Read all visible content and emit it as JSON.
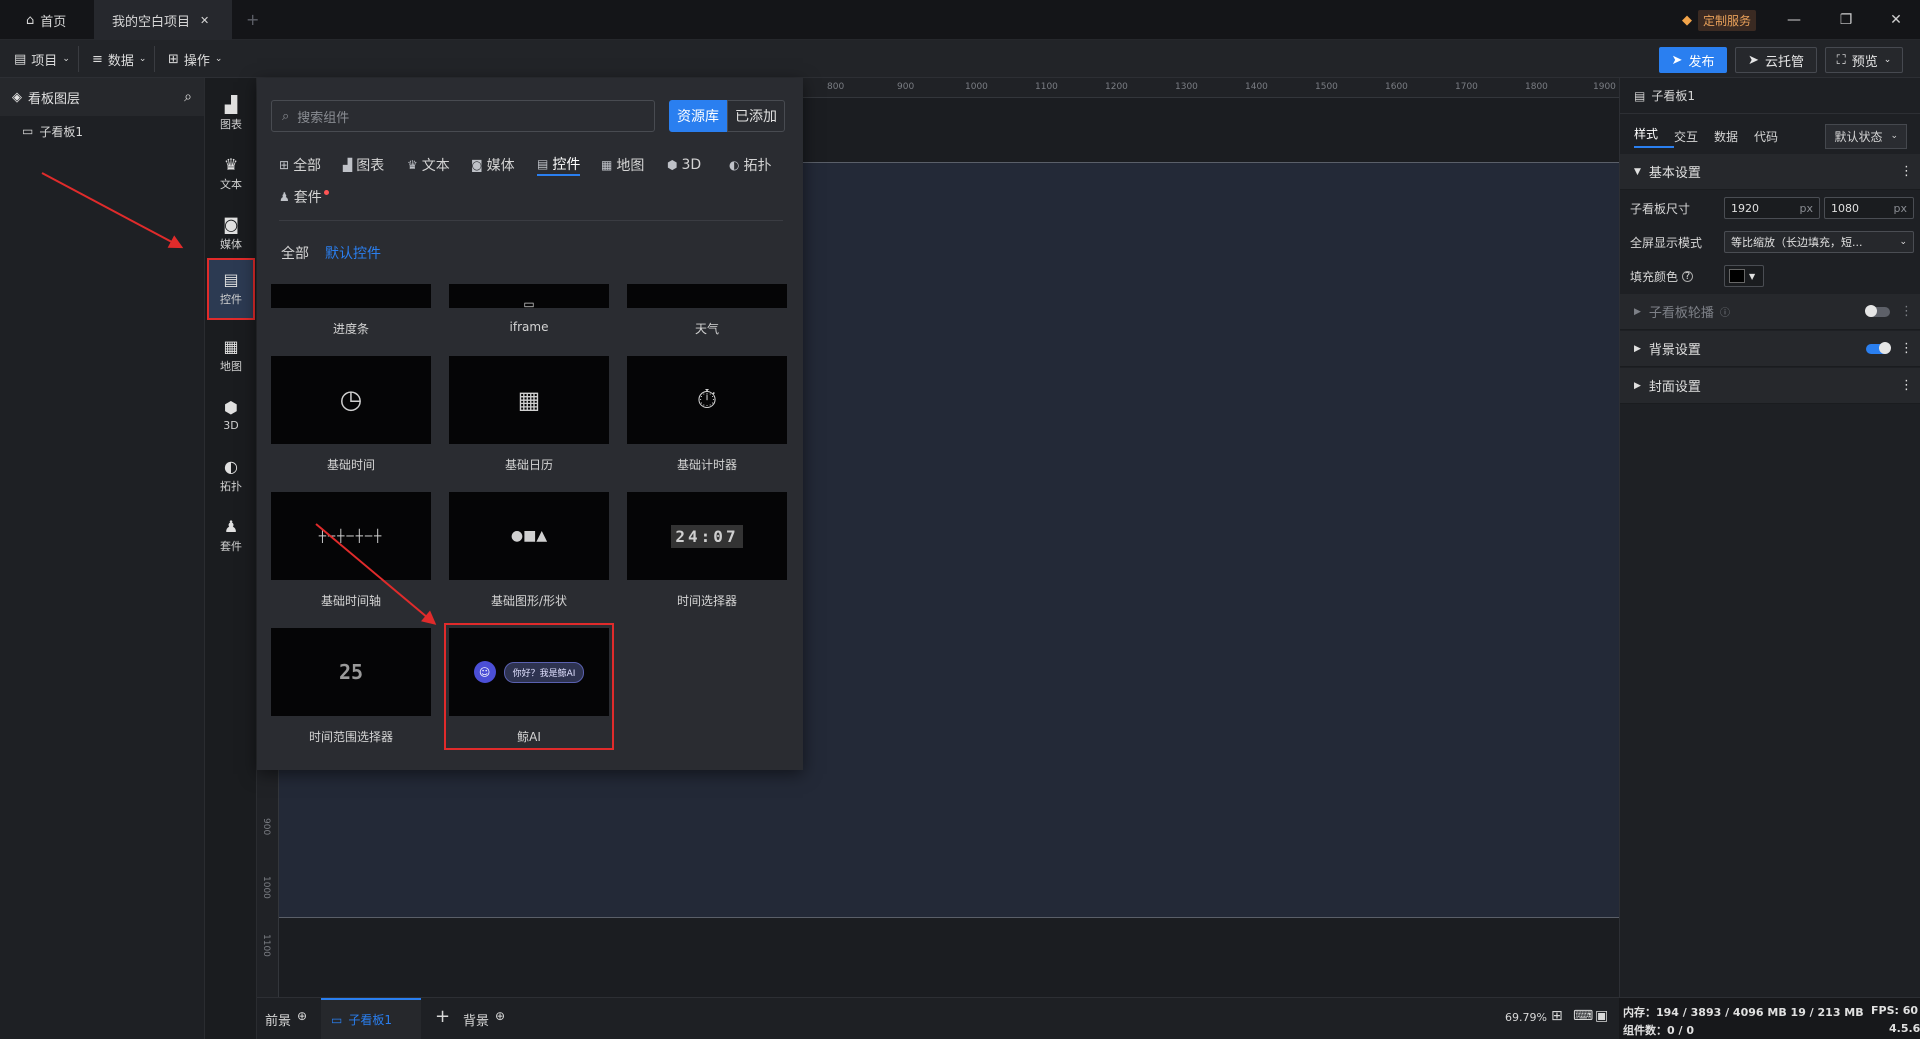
{
  "titlebar": {
    "tabs": [
      {
        "label": "首页"
      },
      {
        "label": "我的空白项目"
      }
    ],
    "custom_service": "定制服务"
  },
  "menubar": {
    "menus": [
      {
        "label": "项目"
      },
      {
        "label": "数据"
      },
      {
        "label": "操作"
      }
    ],
    "publish": "发布",
    "cloud": "云托管",
    "preview": "预览"
  },
  "layers": {
    "title": "看板图层",
    "items": [
      {
        "label": "子看板1"
      }
    ]
  },
  "sidebar": {
    "items": [
      {
        "label": "图表"
      },
      {
        "label": "文本"
      },
      {
        "label": "媒体"
      },
      {
        "label": "控件"
      },
      {
        "label": "地图"
      },
      {
        "label": "3D"
      },
      {
        "label": "拓扑"
      },
      {
        "label": "套件"
      }
    ]
  },
  "panel": {
    "search_placeholder": "搜索组件",
    "source_tabs": [
      "资源库",
      "已添加"
    ],
    "categories": [
      "全部",
      "图表",
      "文本",
      "媒体",
      "控件",
      "地图",
      "3D",
      "拓扑",
      "套件"
    ],
    "sub_tabs": [
      "全部",
      "默认控件"
    ],
    "components": [
      {
        "label": "进度条"
      },
      {
        "label": "iframe"
      },
      {
        "label": "天气"
      },
      {
        "label": "基础时间"
      },
      {
        "label": "基础日历"
      },
      {
        "label": "基础计时器"
      },
      {
        "label": "基础时间轴"
      },
      {
        "label": "基础图形/形状"
      },
      {
        "label": "时间选择器"
      },
      {
        "label": "时间范围选择器"
      },
      {
        "label": "鲸AI"
      }
    ],
    "time_picker_digits": "24:07",
    "ai_bubble": "你好？我是鲸AI",
    "range_digits": "25"
  },
  "ruler": {
    "top_ticks": [
      "800",
      "900",
      "1000",
      "1100",
      "1200",
      "1300",
      "1400",
      "1500",
      "1600",
      "1700",
      "1800",
      "1900"
    ],
    "left_ticks": [
      "900",
      "1000",
      "1100"
    ]
  },
  "props": {
    "title": "子看板1",
    "tabs": [
      "样式",
      "交互",
      "数据",
      "代码"
    ],
    "state_select": "默认状态",
    "basic_section": "基本设置",
    "size_label": "子看板尺寸",
    "width": "1920",
    "height": "1080",
    "unit": "px",
    "fullscreen_label": "全屏显示模式",
    "fullscreen_value": "等比缩放（长边填充，短...",
    "fill_label": "填充颜色",
    "carousel_section": "子看板轮播",
    "bg_section": "背景设置",
    "cover_section": "封面设置"
  },
  "bottombar": {
    "front": "前景",
    "board": "子看板1",
    "back": "背景",
    "zoom": "69.79%"
  },
  "status": {
    "memory": "内存：194 / 3893 / 4096 MB  19 / 213 MB",
    "fps": "FPS:  60",
    "count": "组件数：0 / 0",
    "version": "4.5.6"
  },
  "colors": {
    "accent": "#2a7ff0",
    "highlight": "#e02b2b"
  }
}
